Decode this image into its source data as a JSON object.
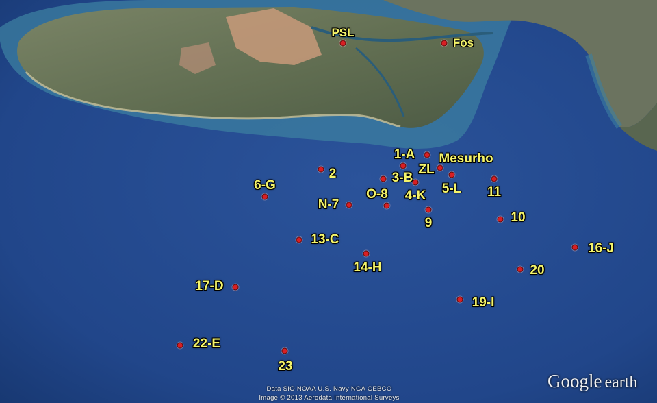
{
  "attribution": {
    "data_line": "Data SIO  NOAA  U.S. Navy  NGA  GEBCO",
    "image_line": "Image © 2013 Aerodata International Surveys"
  },
  "logo": {
    "google": "Google",
    "earth": "earth"
  },
  "colors": {
    "sea": "#23488a",
    "land": "#6d7a5a",
    "marker": "#d81f24",
    "label": "#f4f46a"
  },
  "labels": {
    "psl": "PSL",
    "fos": "Fos",
    "mesurho": "Mesurho",
    "zl": "ZL",
    "s1a": "1-A",
    "s2": "2",
    "s3b": "3-B",
    "s4k": "4-K",
    "s5l": "5-L",
    "s6g": "6-G",
    "n7": "N-7",
    "o8": "O-8",
    "s9": "9",
    "s10": "10",
    "s11": "11",
    "s13c": "13-C",
    "s14h": "14-H",
    "s16j": "16-J",
    "s17d": "17-D",
    "s19i": "19-I",
    "s20": "20",
    "s22e": "22-E",
    "s23": "23"
  }
}
